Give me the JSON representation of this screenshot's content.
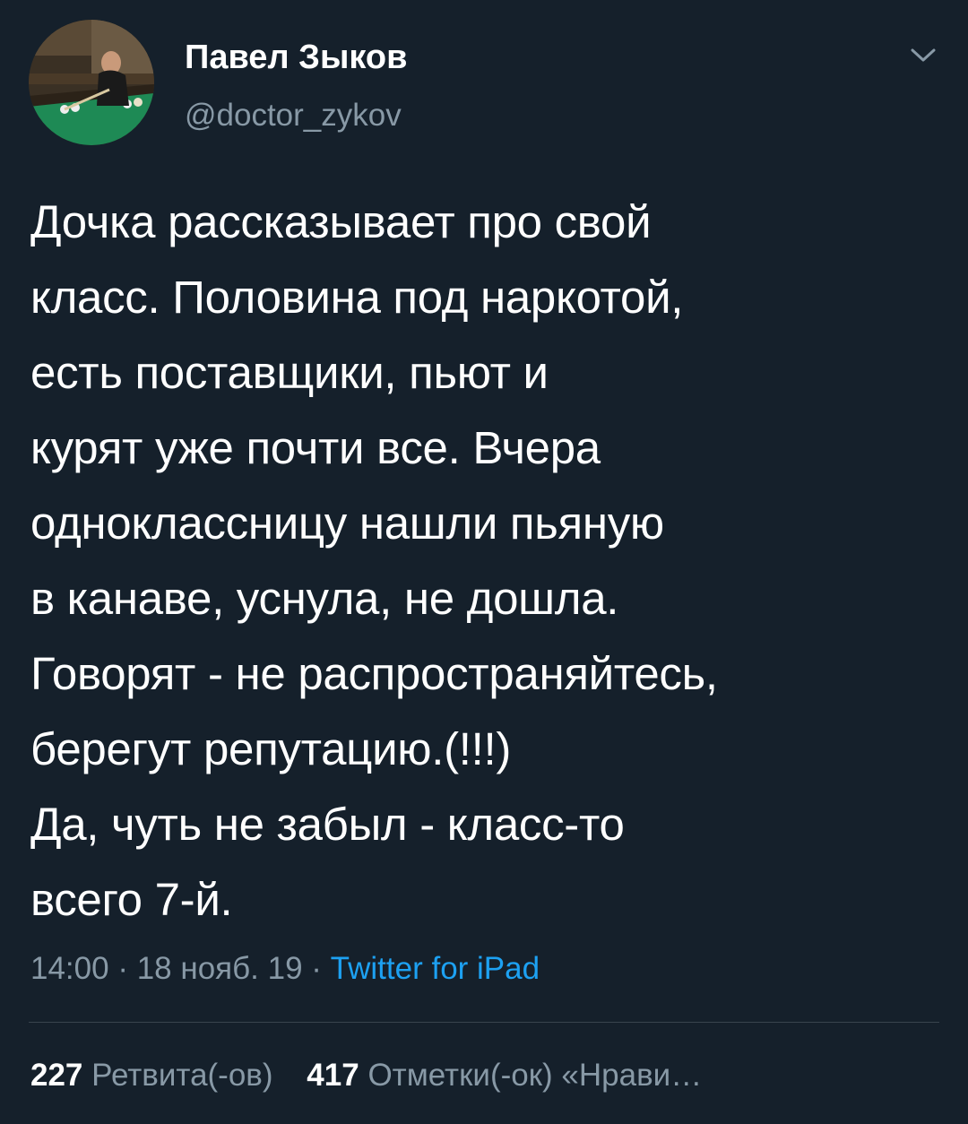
{
  "author": {
    "display_name": "Павел Зыков",
    "handle": "@doctor_zykov"
  },
  "tweet": {
    "text": "Дочка рассказывает про свой\nкласс. Половина под наркотой,\nесть поставщики, пьют и\nкурят уже почти все. Вчера\nодноклассницу нашли пьяную\nв канаве, уснула, не дошла.\nГоворят - не распространяйтесь,\nберегут репутацию.(!!!)\nДа, чуть не забыл - класс-то\nвсего 7-й."
  },
  "meta": {
    "time": "14:00",
    "sep1": "·",
    "date": "18 нояб. 19",
    "sep2": "·",
    "source": "Twitter for iPad"
  },
  "stats": {
    "retweets_count": "227",
    "retweets_label": "Ретвита(-ов)",
    "likes_count": "417",
    "likes_label": "Отметки(-ок) «Нрави…"
  },
  "icons": {
    "menu": "chevron-down-icon"
  },
  "colors": {
    "background": "#15202b",
    "secondary_text": "#8899a6",
    "link": "#1da1f2",
    "divider": "#38444d"
  }
}
